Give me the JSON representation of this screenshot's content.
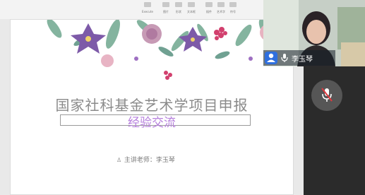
{
  "ribbon": {
    "items": [
      {
        "label": "Execute",
        "pos": 209
      },
      {
        "label": "图片",
        "pos": 235
      },
      {
        "label": "形状",
        "pos": 253
      },
      {
        "label": "文本框",
        "pos": 271
      },
      {
        "label": "插件",
        "pos": 296
      },
      {
        "label": "艺术字",
        "pos": 313
      },
      {
        "label": "符号",
        "pos": 330
      }
    ]
  },
  "slide": {
    "title": "国家社科基金艺术学项目申报",
    "subtitle": "经验交流",
    "lecturer": "主讲老师：李玉琴",
    "person_icon_glyph": "♙"
  },
  "video": {
    "participant_name": "李玉琴"
  },
  "icons": {
    "user": "user-icon",
    "mic": "microphone-icon",
    "mic_muted": "microphone-muted-icon"
  },
  "colors": {
    "subtitle": "#b57edc",
    "title": "#8a8a8a",
    "user_button": "#2f6fde"
  }
}
